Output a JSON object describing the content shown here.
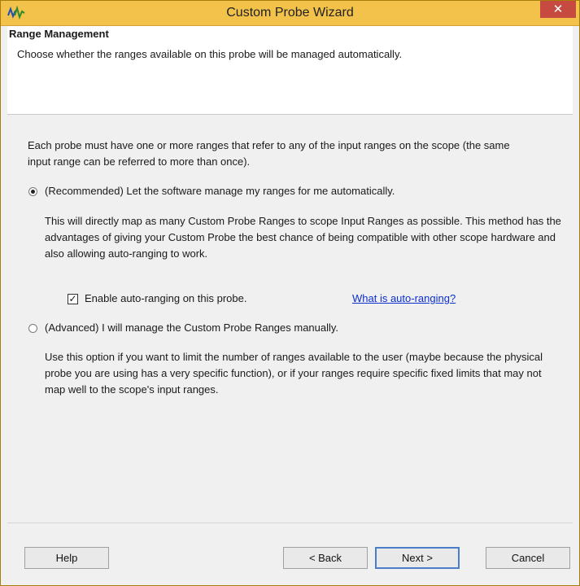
{
  "window": {
    "title": "Custom Probe Wizard",
    "close_glyph": "✕",
    "accent_color": "#f2c24a"
  },
  "header": {
    "title": "Range Management",
    "subtitle": "Choose whether the ranges available on this probe will be managed automatically."
  },
  "content": {
    "intro": "Each probe must have one or more ranges that refer to any of the input ranges on the scope (the same input range can be referred to more than once).",
    "option_recommended": {
      "label": "(Recommended) Let the software manage my ranges for me automatically.",
      "checked": true,
      "description": "This will directly map as many Custom Probe Ranges to scope Input Ranges as possible. This method has the advantages of giving your Custom Probe the best chance of being compatible with other scope hardware and also allowing auto-ranging to work.",
      "autorange_checkbox_label": "Enable auto-ranging on this probe.",
      "autorange_checked": true,
      "autorange_check_glyph": "✓",
      "help_link": "What is auto-ranging?"
    },
    "option_advanced": {
      "label": "(Advanced) I will manage the Custom Probe Ranges manually.",
      "checked": false,
      "description": "Use this option if you want to limit the number of ranges available to the user (maybe because the physical probe you are using has a very specific function), or if your ranges require specific fixed limits that may not map well to the scope's input ranges."
    }
  },
  "footer": {
    "help_label": "Help",
    "back_label": "< Back",
    "next_label": "Next >",
    "cancel_label": "Cancel"
  }
}
